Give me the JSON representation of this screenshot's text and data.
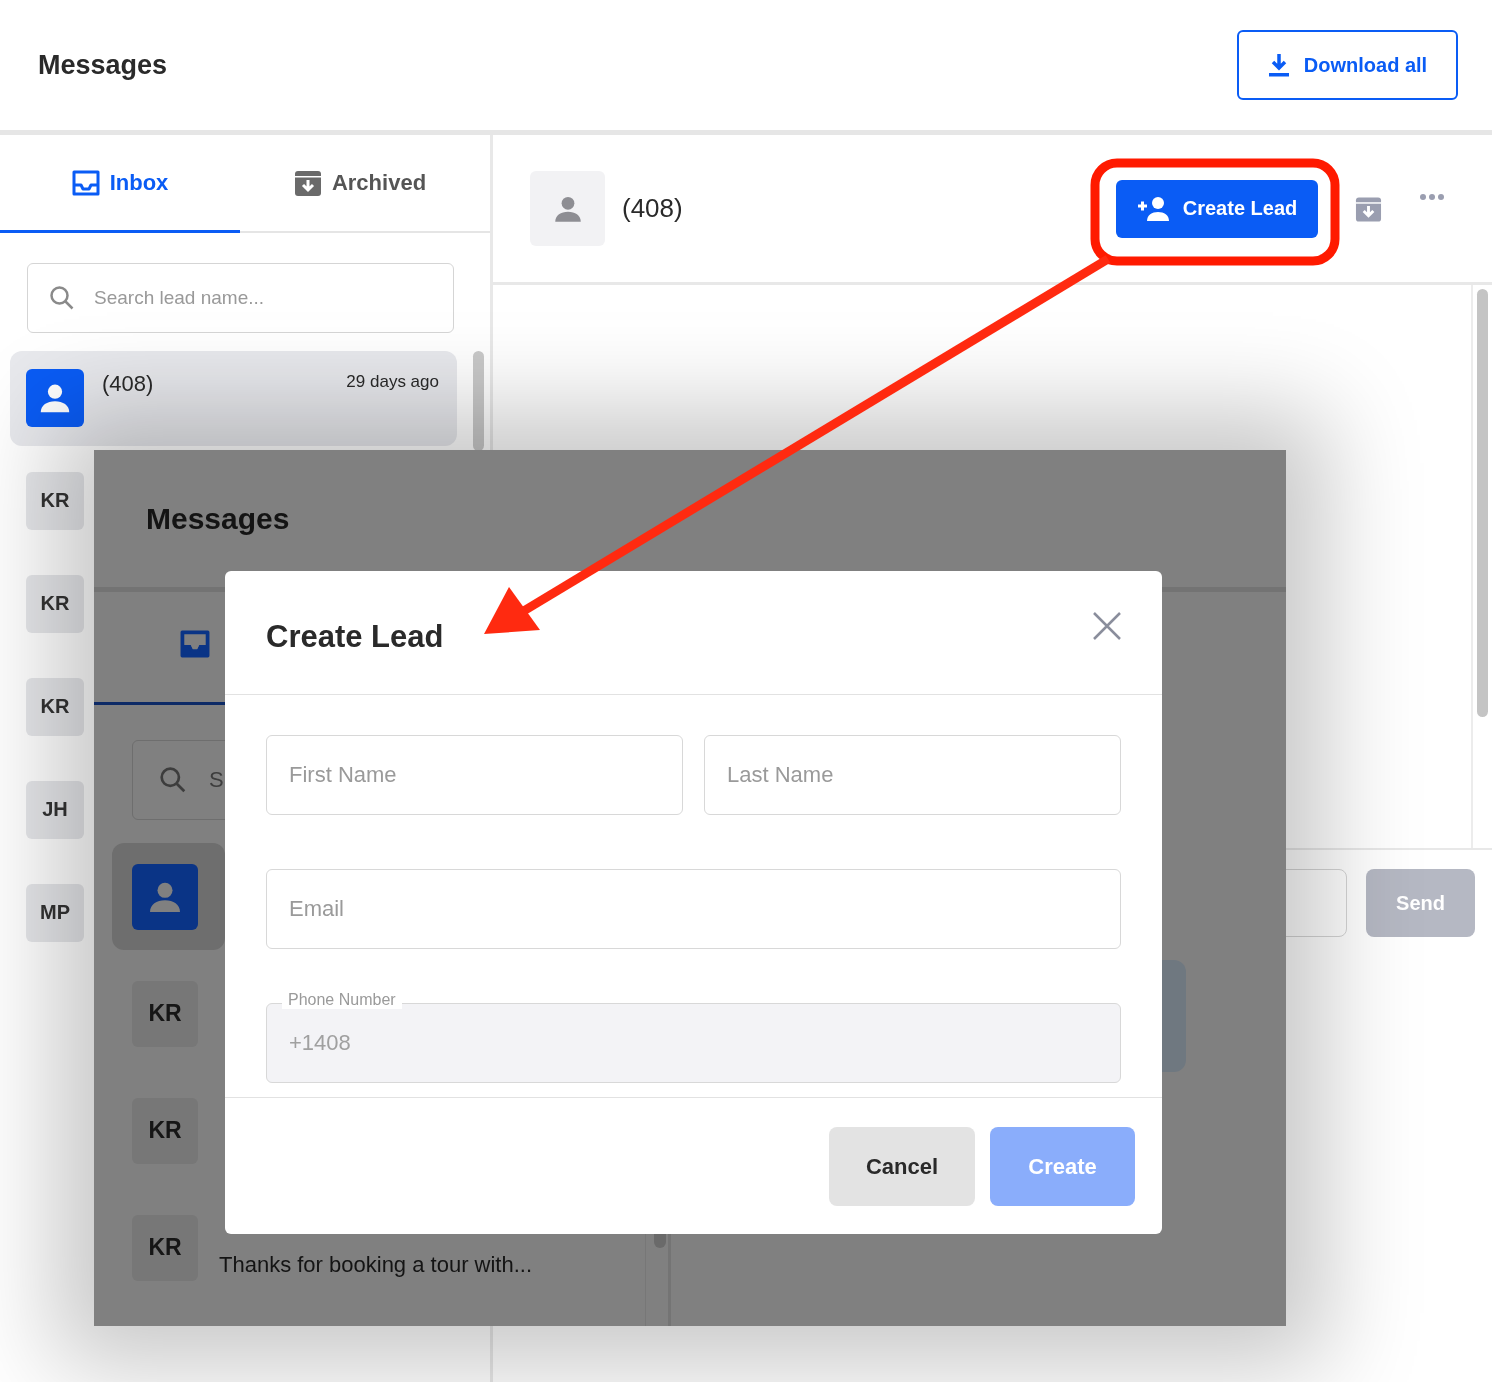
{
  "header": {
    "title": "Messages",
    "download_button": "Download all"
  },
  "tabs": [
    {
      "label": "Inbox",
      "selected": true
    },
    {
      "label": "Archived",
      "selected": false
    }
  ],
  "search": {
    "placeholder": "Search lead name..."
  },
  "conversations": [
    {
      "kind": "contact",
      "name": "(408)",
      "time": "29 days ago",
      "selected": true
    },
    {
      "kind": "initials",
      "initials": "KR",
      "selected": false
    },
    {
      "kind": "initials",
      "initials": "KR",
      "selected": false
    },
    {
      "kind": "initials",
      "initials": "KR",
      "selected": false
    },
    {
      "kind": "initials",
      "initials": "JH",
      "selected": false
    },
    {
      "kind": "initials",
      "initials": "MP",
      "selected": false
    }
  ],
  "conversation": {
    "name": "(408)",
    "create_lead_button": "Create Lead"
  },
  "composer": {
    "send_button": "Send",
    "disabled": true
  },
  "inset": {
    "title": "Messages",
    "search_placeholder": "S",
    "conversations": [
      {
        "kind": "contact",
        "selected": true
      },
      {
        "kind": "initials",
        "initials": "KR",
        "selected": false
      },
      {
        "kind": "initials",
        "initials": "KR",
        "selected": false
      },
      {
        "kind": "initials",
        "initials": "KR",
        "preview": "Thanks for booking a tour with...",
        "selected": false
      }
    ]
  },
  "modal": {
    "title": "Create Lead",
    "fields": [
      {
        "placeholder": "First Name",
        "disabled": false
      },
      {
        "placeholder": "Last Name",
        "disabled": false
      },
      {
        "placeholder": "Email",
        "disabled": false
      },
      {
        "label": "Phone Number",
        "value": "+1408",
        "disabled": true
      }
    ],
    "buttons": [
      {
        "label": "Cancel",
        "kind": "secondary",
        "disabled": false
      },
      {
        "label": "Create",
        "kind": "primary",
        "disabled": true
      }
    ]
  }
}
